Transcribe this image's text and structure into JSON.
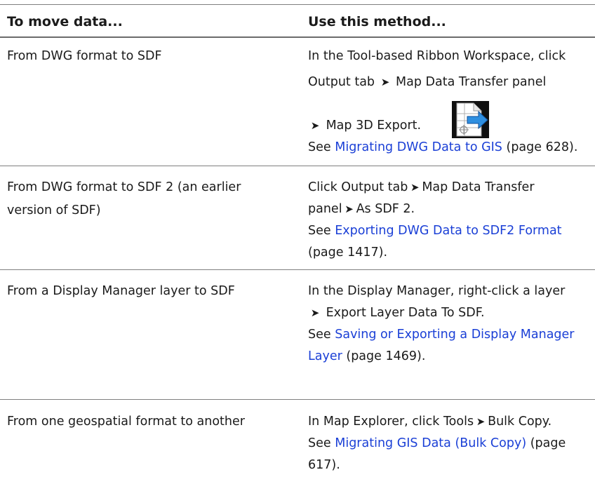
{
  "header": {
    "col1": "To move data...",
    "col2": "Use this method..."
  },
  "rows": [
    {
      "from": "From DWG format to SDF",
      "method": {
        "l1": "In the Tool-based Ribbon Workspace, click",
        "l2a": "Output tab",
        "l2b": "Map Data Transfer panel",
        "l3": "Map 3D Export.",
        "see_prefix": "See",
        "see_link": "Migrating DWG Data to GIS",
        "see_page": "(page 628)."
      },
      "icon": "map-3d-export-icon"
    },
    {
      "from_l1": "From DWG format to SDF 2 (an earlier",
      "from_l2": "version of SDF)",
      "method": {
        "l1a": "Click Output tab",
        "l1b": "Map Data Transfer",
        "l2a": "panel",
        "l2b": "As SDF 2.",
        "see_prefix": "See",
        "see_link": "Exporting DWG Data to SDF2 Format",
        "see_page": "(page 1417)."
      }
    },
    {
      "from": "From a Display Manager layer to SDF",
      "method": {
        "l1": "In the Display Manager, right-click a layer",
        "l2": "Export Layer Data To SDF.",
        "see_prefix": "See",
        "see_link_l1": "Saving or Exporting a Display Manager",
        "see_link_l2": "Layer",
        "see_page": "(page 1469)."
      }
    },
    {
      "from": "From one geospatial format to another",
      "method": {
        "l1a": "In Map Explorer, click Tools",
        "l1b": "Bulk Copy.",
        "see_prefix": "See",
        "see_link": "Migrating GIS Data (Bulk Copy)",
        "see_page_a": "(page",
        "see_page_b": "617)."
      }
    }
  ],
  "glyphs": {
    "arrow": "➤"
  },
  "colors": {
    "link": "#1a3fd6",
    "rule": "#7f7f7f",
    "icon_arrow": "#2f8fe0"
  }
}
